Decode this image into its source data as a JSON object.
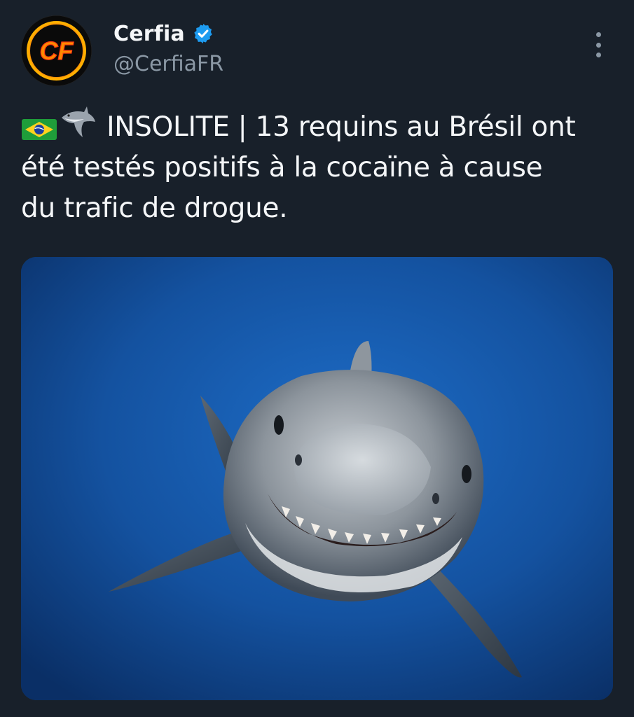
{
  "author": {
    "display_name": "Cerfia",
    "handle": "@CerfiaFR",
    "avatar_text": "CF",
    "verified": true
  },
  "tweet": {
    "emoji": [
      "brazil-flag",
      "shark"
    ],
    "line1": "INSOLITE | 13 requins au Brésil ont",
    "line2": "été testés positifs à la cocaïne à cause",
    "line3": "du trafic de drogue."
  },
  "media": {
    "subject": "shark-photo"
  },
  "colors": {
    "background": "#18202a",
    "text": "#f4f6f8",
    "secondary_text": "#8b98a5",
    "verified_blue": "#1d9bf0",
    "ocean": "#1559a8"
  }
}
